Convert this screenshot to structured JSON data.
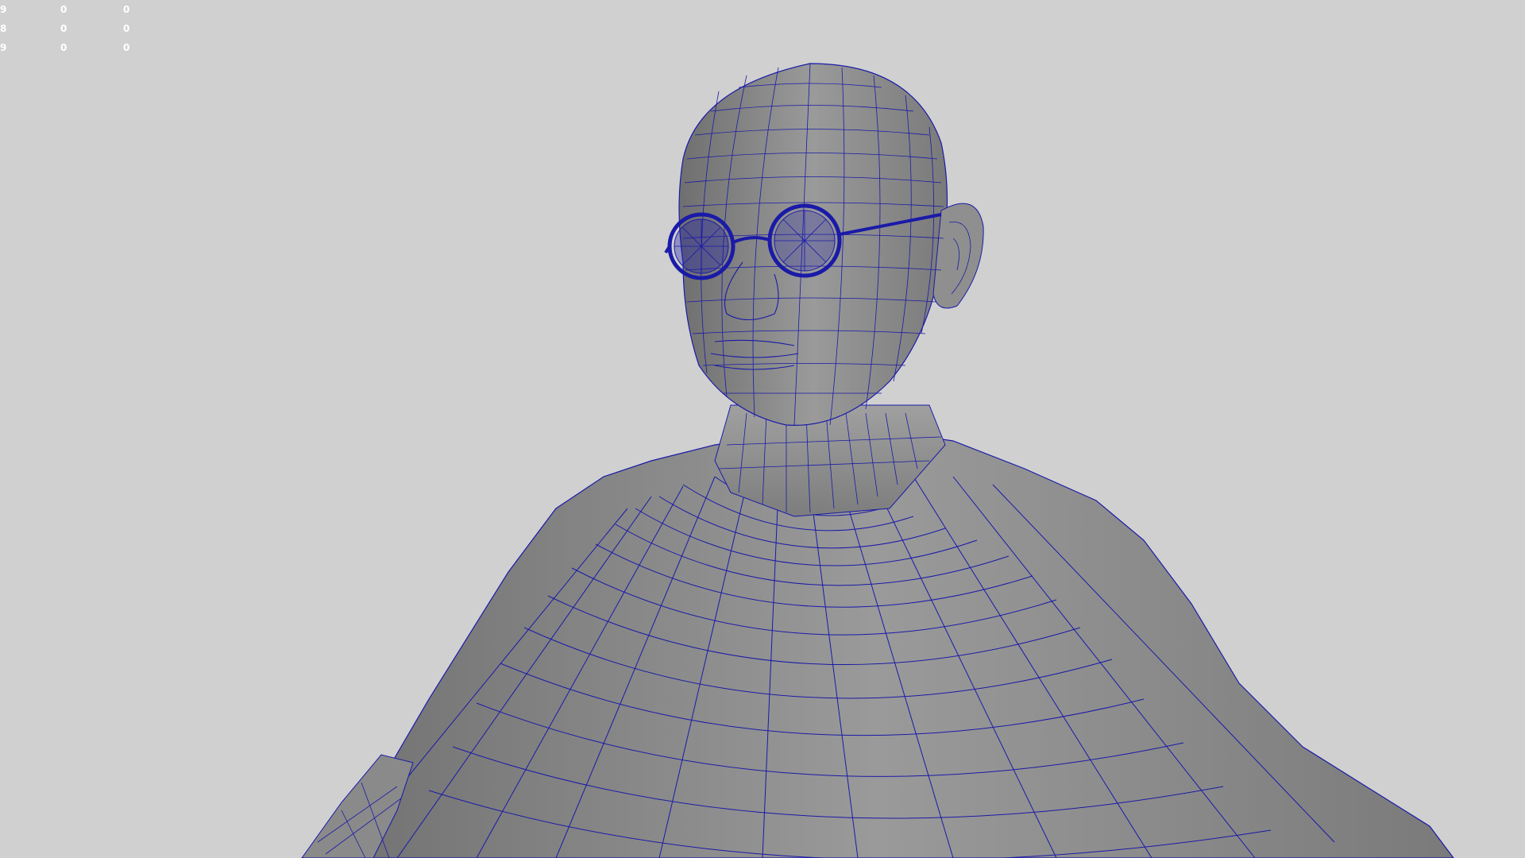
{
  "viewport": {
    "background_color": "#d0d0d0",
    "wireframe_color": "#1a1aa8",
    "mesh_fill_color": "#8c8c8c",
    "heads_up_display": {
      "rows": [
        [
          "9",
          "0",
          "0"
        ],
        [
          "8",
          "0",
          "0"
        ],
        [
          "9",
          "0",
          "0"
        ]
      ]
    },
    "model": {
      "description_icon": "wireframe-bust-model",
      "accessory_icon": "round-glasses-icon"
    }
  }
}
